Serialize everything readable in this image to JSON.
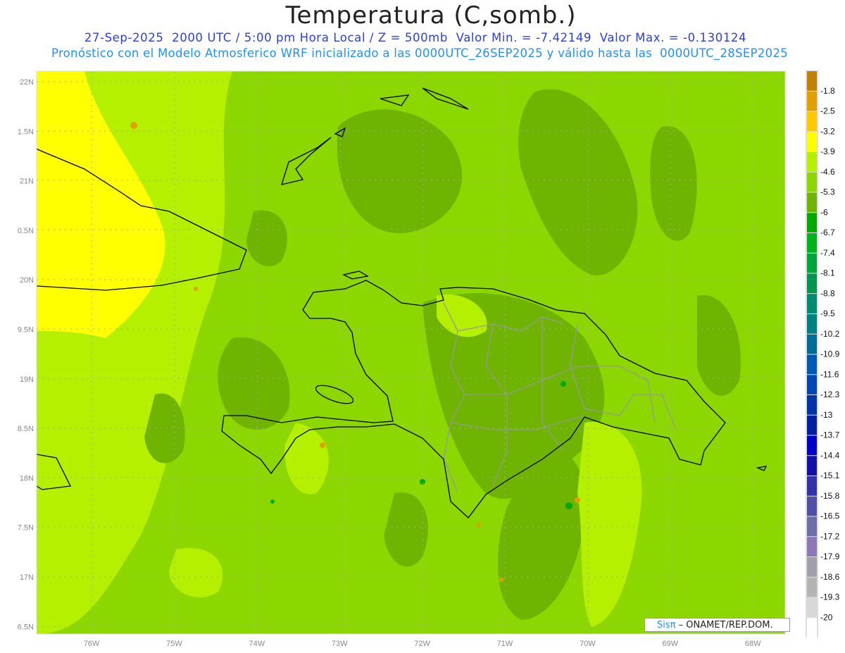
{
  "header": {
    "title": "Temperatura (C,somb.)",
    "line1": "27-Sep-2025  2000 UTC / 5:00 pm Hora Local / Z = 500mb  Valor Min. = -7.42149  Valor Max. = -0.130124",
    "line2": "Pronóstico con el Modelo Atmosferico WRF inicializado a las 0000UTC_26SEP2025 y válido hasta las  0000UTC_28SEP2025"
  },
  "axes": {
    "lat_labels": [
      "22N",
      "1.5N",
      "21N",
      "0.5N",
      "20N",
      "9.5N",
      "19N",
      "8.5N",
      "18N",
      "7.5N",
      "17N",
      "6.5N"
    ],
    "lon_labels": [
      "76W",
      "75W",
      "74W",
      "73W",
      "72W",
      "71W",
      "70W",
      "69W",
      "68W"
    ]
  },
  "colorbar": {
    "labels": [
      "-1.8",
      "-2.5",
      "-3.2",
      "-3.9",
      "-4.6",
      "-5.3",
      "-6",
      "-6.7",
      "-7.4",
      "-8.1",
      "-8.8",
      "-9.5",
      "-10.2",
      "-10.9",
      "-11.6",
      "-12.3",
      "-13",
      "-13.7",
      "-14.4",
      "-15.1",
      "-15.8",
      "-16.5",
      "-17.2",
      "-17.9",
      "-18.6",
      "-19.3",
      "-20"
    ],
    "colors": [
      "#c08000",
      "#e0a000",
      "#ffc800",
      "#ffff00",
      "#b4f000",
      "#8cd700",
      "#6eb400",
      "#00aa00",
      "#00b41e",
      "#00a53c",
      "#009650",
      "#008c6e",
      "#008080",
      "#006e96",
      "#005ab4",
      "#0046b4",
      "#0032aa",
      "#0020a0",
      "#0000c8",
      "#1010aa",
      "#3232aa",
      "#5050aa",
      "#6e6eaa",
      "#8c78b4",
      "#a0a0aa",
      "#b4b4b4",
      "#d7d7d7",
      "#ffffff"
    ]
  },
  "credit": {
    "logo": "Sisπ",
    "text": "– ONAMET/REP.DOM."
  }
}
